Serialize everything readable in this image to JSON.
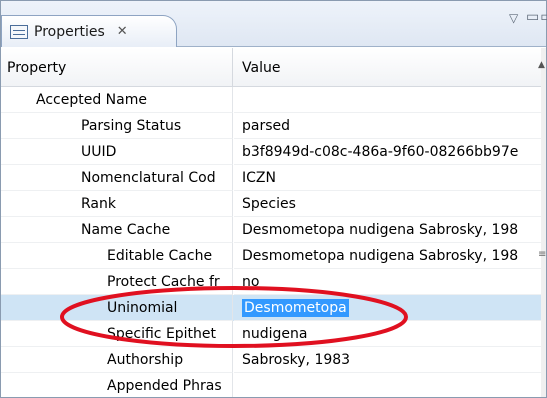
{
  "tab": {
    "title": "Properties",
    "close_glyph": "✕",
    "icon": "properties-icon"
  },
  "toolbar": {
    "view_menu_glyph": "▽",
    "minimize_glyph": "▭▭"
  },
  "table": {
    "headers": [
      "Property",
      "Value"
    ],
    "rows": [
      {
        "property": "Accepted Name",
        "value": ""
      },
      {
        "property": "Parsing Status",
        "value": "parsed"
      },
      {
        "property": "UUID",
        "value": "b3f8949d-c08c-486a-9f60-08266bb97e"
      },
      {
        "property": "Nomenclatural Cod",
        "value": "ICZN"
      },
      {
        "property": "Rank",
        "value": "Species"
      },
      {
        "property": "Name Cache",
        "value": "Desmometopa nudigena Sabrosky, 198"
      },
      {
        "property": "Editable Cache",
        "value": "Desmometopa nudigena Sabrosky, 198"
      },
      {
        "property": "Protect Cache fr",
        "value": "no"
      },
      {
        "property": "Uninomial",
        "value": "Desmometopa"
      },
      {
        "property": "Specific Epithet",
        "value": "nudigena"
      },
      {
        "property": "Authorship",
        "value": "Sabrosky, 1983"
      },
      {
        "property": "Appended Phras",
        "value": ""
      }
    ]
  },
  "colors": {
    "selection": "#cfe4f5",
    "edit_highlight": "#3399ff",
    "annotation": "#e01020"
  }
}
